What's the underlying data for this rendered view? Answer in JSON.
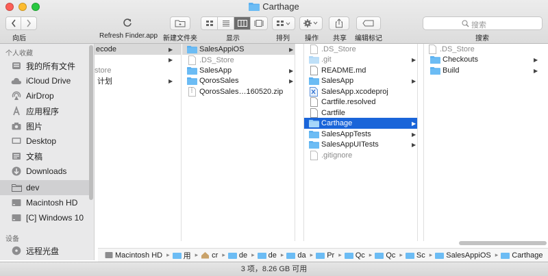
{
  "window": {
    "title": "Carthage"
  },
  "toolbar": {
    "back_forward_label": "向后",
    "refresh_label": "Refresh Finder.app",
    "new_folder_label": "新建文件夹",
    "view_label": "显示",
    "arrange_label": "排列",
    "action_label": "操作",
    "share_label": "共享",
    "tags_label": "编辑标记",
    "search_label": "搜索",
    "search_placeholder": "搜索"
  },
  "sidebar": {
    "favorites_header": "个人收藏",
    "favorites": [
      {
        "label": "我的所有文件",
        "icon": "all-files-icon"
      },
      {
        "label": "iCloud Drive",
        "icon": "cloud-icon"
      },
      {
        "label": "AirDrop",
        "icon": "airdrop-icon"
      },
      {
        "label": "应用程序",
        "icon": "applications-icon"
      },
      {
        "label": "图片",
        "icon": "camera-icon"
      },
      {
        "label": "Desktop",
        "icon": "desktop-icon"
      },
      {
        "label": "文稿",
        "icon": "documents-icon"
      },
      {
        "label": "Downloads",
        "icon": "downloads-icon"
      },
      {
        "label": "dev",
        "icon": "folder-icon"
      },
      {
        "label": "Macintosh HD",
        "icon": "disk-icon"
      },
      {
        "label": "[C] Windows 10",
        "icon": "disk-icon"
      }
    ],
    "devices_header": "设备",
    "devices": [
      {
        "label": "远程光盘",
        "icon": "optical-disc-icon"
      }
    ]
  },
  "columns": {
    "col1": [
      {
        "label": "ecode",
        "arrow": true,
        "selected": "gray"
      },
      {
        "label": "",
        "arrow": true
      },
      {
        "label": "store",
        "dim": true
      },
      {
        "label": "计划",
        "arrow": true
      }
    ],
    "col2": [
      {
        "label": "SalesAppiOS",
        "type": "folder",
        "arrow": true,
        "selected": "gray"
      },
      {
        "label": ".DS_Store",
        "type": "file",
        "dim": true
      },
      {
        "label": "SalesApp",
        "type": "folder",
        "arrow": true
      },
      {
        "label": "QorosSales",
        "type": "folder",
        "arrow": true
      },
      {
        "label": "QorosSales…160520.zip",
        "type": "zip"
      }
    ],
    "col3": [
      {
        "label": ".DS_Store",
        "type": "file",
        "dim": true
      },
      {
        "label": ".git",
        "type": "folder-light",
        "dim": true,
        "arrow": true
      },
      {
        "label": "README.md",
        "type": "file"
      },
      {
        "label": "SalesApp",
        "type": "folder",
        "arrow": true
      },
      {
        "label": "SalesApp.xcodeproj",
        "type": "xcode"
      },
      {
        "label": "Cartfile.resolved",
        "type": "file"
      },
      {
        "label": "Cartfile",
        "type": "file"
      },
      {
        "label": "Carthage",
        "type": "folder",
        "arrow": true,
        "selected": "blue"
      },
      {
        "label": "SalesAppTests",
        "type": "folder",
        "arrow": true
      },
      {
        "label": "SalesAppUITests",
        "type": "folder",
        "arrow": true
      },
      {
        "label": ".gitignore",
        "type": "file",
        "dim": true
      }
    ],
    "col4": [
      {
        "label": ".DS_Store",
        "type": "file",
        "dim": true
      },
      {
        "label": "Checkouts",
        "type": "folder",
        "arrow": true
      },
      {
        "label": "Build",
        "type": "folder",
        "arrow": true
      }
    ]
  },
  "pathbar": [
    {
      "label": "Macintosh HD",
      "icon": "disk-icon"
    },
    {
      "label": "用",
      "icon": "folder-icon"
    },
    {
      "label": "cr",
      "icon": "home-icon"
    },
    {
      "label": "de",
      "icon": "folder-icon"
    },
    {
      "label": "de",
      "icon": "folder-icon"
    },
    {
      "label": "da",
      "icon": "folder-icon"
    },
    {
      "label": "Pr",
      "icon": "folder-icon"
    },
    {
      "label": "Qc",
      "icon": "folder-icon"
    },
    {
      "label": "Qc",
      "icon": "folder-icon"
    },
    {
      "label": "Sc",
      "icon": "folder-icon"
    },
    {
      "label": "SalesAppiOS",
      "icon": "folder-icon"
    },
    {
      "label": "Carthage",
      "icon": "folder-icon"
    }
  ],
  "status": {
    "text": "3 项，8.26 GB 可用"
  },
  "colors": {
    "folder": "#5ab0f0",
    "selection_blue": "#1a65d9",
    "selection_gray": "#d9d9d9"
  }
}
